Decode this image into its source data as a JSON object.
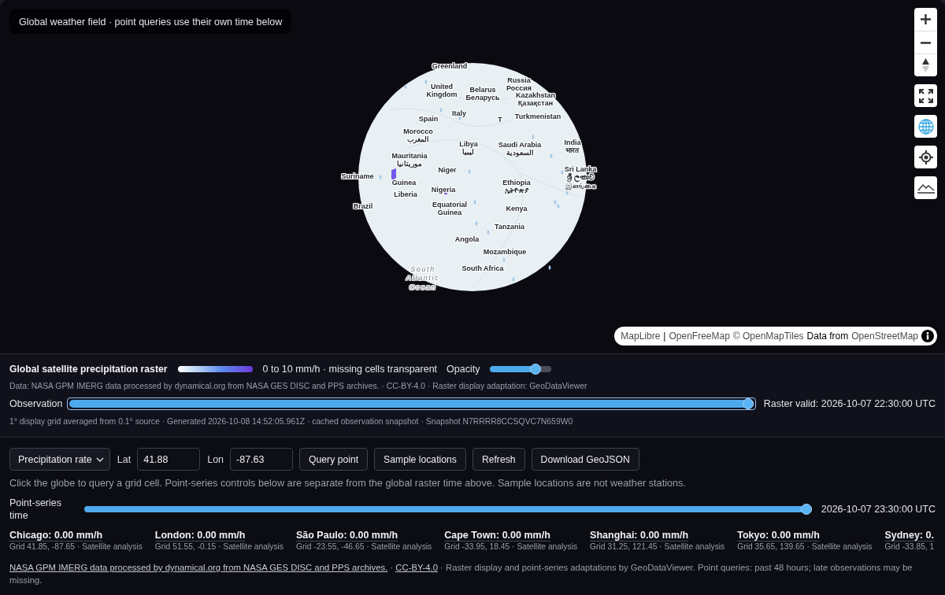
{
  "map": {
    "caption": "Global weather field · point queries use their own time below",
    "globe_view_on": true,
    "labels": [
      {
        "kind": "country",
        "lines": [
          "Greenland"
        ]
      },
      {
        "kind": "country",
        "lines": [
          "Russia",
          "Россия"
        ]
      },
      {
        "kind": "country",
        "lines": [
          "United",
          "Kingdom"
        ]
      },
      {
        "kind": "country",
        "lines": [
          "Belarus",
          "Беларусь"
        ]
      },
      {
        "kind": "country",
        "lines": [
          "Kazakhstan",
          "Қазақстан"
        ]
      },
      {
        "kind": "country",
        "lines": [
          "Spain"
        ]
      },
      {
        "kind": "country",
        "lines": [
          "Italy"
        ]
      },
      {
        "kind": "country",
        "lines": [
          "T"
        ]
      },
      {
        "kind": "country",
        "lines": [
          "Turkmenistan"
        ]
      },
      {
        "kind": "country",
        "lines": [
          "Morocco",
          "المغرب"
        ]
      },
      {
        "kind": "country",
        "lines": [
          "Libya",
          "ليبيا"
        ]
      },
      {
        "kind": "country",
        "lines": [
          "Saudi Arabia",
          "السعودية"
        ]
      },
      {
        "kind": "country",
        "lines": [
          "India",
          "भारत"
        ]
      },
      {
        "kind": "country",
        "lines": [
          "Mauritania",
          "موريتانيا"
        ]
      },
      {
        "kind": "country",
        "lines": [
          "Niger"
        ]
      },
      {
        "kind": "country",
        "lines": [
          "Suriname"
        ]
      },
      {
        "kind": "country",
        "lines": [
          "Guinea"
        ]
      },
      {
        "kind": "country",
        "lines": [
          "Sri Lanka",
          "ශ්‍රී ලංකාව",
          "இலங்கை"
        ]
      },
      {
        "kind": "country",
        "lines": [
          "Liberia"
        ]
      },
      {
        "kind": "country",
        "lines": [
          "Nigeria"
        ]
      },
      {
        "kind": "country",
        "lines": [
          "Ethiopia",
          "ኢትዮጵያ"
        ]
      },
      {
        "kind": "country",
        "lines": [
          "Brazil"
        ]
      },
      {
        "kind": "country",
        "lines": [
          "Equatorial",
          "Guinea"
        ]
      },
      {
        "kind": "country",
        "lines": [
          "Kenya"
        ]
      },
      {
        "kind": "country",
        "lines": [
          "Tanzania"
        ]
      },
      {
        "kind": "country",
        "lines": [
          "Angola"
        ]
      },
      {
        "kind": "country",
        "lines": [
          "Mozambique"
        ]
      },
      {
        "kind": "country",
        "lines": [
          "South Africa"
        ]
      },
      {
        "kind": "water",
        "lines": [
          "South",
          "Atlantic",
          "Ocean"
        ]
      }
    ],
    "attribution": [
      {
        "kind": "link",
        "text": "MapLibre"
      },
      {
        "kind": "text",
        "text": "|"
      },
      {
        "kind": "link",
        "text": "OpenFreeMap"
      },
      {
        "kind": "link",
        "text": "© OpenMapTiles"
      },
      {
        "kind": "text",
        "text": "Data from"
      },
      {
        "kind": "link",
        "text": "OpenStreetMap"
      }
    ]
  },
  "raster": {
    "title": "Global satellite precipitation raster",
    "legend_range": "0 to 10 mm/h · missing cells transparent",
    "opacity": {
      "label": "Opacity",
      "level": 0.8
    },
    "source_note": "Data: NASA GPM IMERG data processed by dynamical.org from NASA GES DISC and PPS archives. · CC-BY-4.0 · Raster display adaptation: GeoDataViewer",
    "observation": {
      "label": "Observation",
      "level": 1,
      "focused": true,
      "valid_time": "Raster valid: 2026-10-07 22:30:00 UTC"
    },
    "grid_note": "1° display grid averaged from 0.1° source · Generated 2026-10-08 14:52:05.961Z · cached observation snapshot · Snapshot N7RRRR8CCSQVC7N659W0"
  },
  "query": {
    "variable": "Precipitation rate",
    "lat": {
      "label": "Lat",
      "value": "41.88"
    },
    "lon": {
      "label": "Lon",
      "value": "-87.63"
    },
    "buttons": [
      "Query point",
      "Sample locations",
      "Refresh",
      "Download GeoJSON"
    ],
    "help": "Click the globe to query a grid cell. Point-series controls below are separate from the global raster time above. Sample locations are not weather stations.",
    "point_series": {
      "label": "Point-series time",
      "level": 1,
      "time": "2026-10-07 23:30:00 UTC"
    }
  },
  "locations": [
    {
      "reading": "Chicago: 0.00 mm/h",
      "detail": "Grid 41.85, -87.65 · Satellite analysis"
    },
    {
      "reading": "London: 0.00 mm/h",
      "detail": "Grid 51.55, -0.15 · Satellite analysis"
    },
    {
      "reading": "São Paulo: 0.00 mm/h",
      "detail": "Grid -23.55, -46.65 · Satellite analysis"
    },
    {
      "reading": "Cape Town: 0.00 mm/h",
      "detail": "Grid -33.95, 18.45 · Satellite analysis"
    },
    {
      "reading": "Shanghai: 0.00 mm/h",
      "detail": "Grid 31.25, 121.45 · Satellite analysis"
    },
    {
      "reading": "Tokyo: 0.00 mm/h",
      "detail": "Grid 35.65, 139.65 · Satellite analysis"
    },
    {
      "reading": "Sydney: 0.",
      "detail": "Grid -33.85, 1"
    }
  ],
  "footer": [
    {
      "kind": "link",
      "text": "NASA GPM IMERG data processed by dynamical.org from NASA GES DISC and PPS archives."
    },
    {
      "kind": "text",
      "text": "·"
    },
    {
      "kind": "link",
      "text": "CC-BY-4.0"
    },
    {
      "kind": "text",
      "text": "· Raster display and point-series adaptations by GeoDataViewer. Point queries: past 48 hours; late observations may be missing."
    }
  ]
}
